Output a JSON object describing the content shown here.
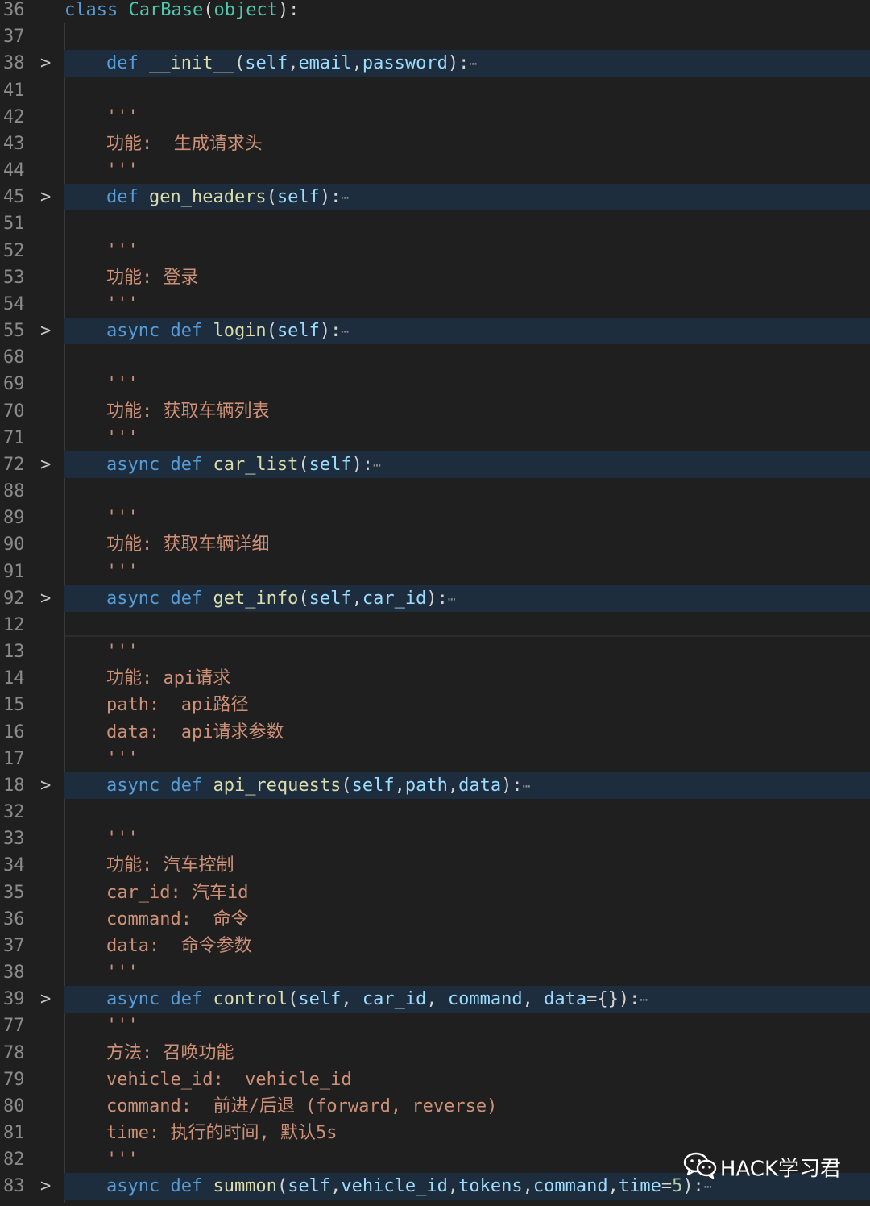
{
  "lines": [
    {
      "n": "36",
      "fold": false,
      "hl": false,
      "indent": false,
      "tokens": [
        [
          "kw",
          "class "
        ],
        [
          "cls",
          "CarBase"
        ],
        [
          "punc",
          "("
        ],
        [
          "cls",
          "object"
        ],
        [
          "punc",
          "):"
        ]
      ]
    },
    {
      "n": "37",
      "fold": false,
      "hl": false,
      "indent": false,
      "tokens": []
    },
    {
      "n": "38",
      "fold": true,
      "hl": true,
      "indent": true,
      "ellipsis": true,
      "tokens": [
        [
          "kw",
          "def "
        ],
        [
          "fn",
          "__init__"
        ],
        [
          "punc",
          "("
        ],
        [
          "param",
          "self"
        ],
        [
          "punc",
          ","
        ],
        [
          "param",
          "email"
        ],
        [
          "punc",
          ","
        ],
        [
          "param",
          "password"
        ],
        [
          "punc",
          "):"
        ]
      ]
    },
    {
      "n": "41",
      "fold": false,
      "hl": false,
      "indent": true,
      "tokens": []
    },
    {
      "n": "42",
      "fold": false,
      "hl": false,
      "indent": true,
      "tokens": [
        [
          "str",
          "'''"
        ]
      ]
    },
    {
      "n": "43",
      "fold": false,
      "hl": false,
      "indent": true,
      "tokens": [
        [
          "str",
          "功能:  生成请求头"
        ]
      ]
    },
    {
      "n": "44",
      "fold": false,
      "hl": false,
      "indent": true,
      "tokens": [
        [
          "str",
          "'''"
        ]
      ]
    },
    {
      "n": "45",
      "fold": true,
      "hl": true,
      "indent": true,
      "ellipsis": true,
      "tokens": [
        [
          "kw",
          "def "
        ],
        [
          "fn",
          "gen_headers"
        ],
        [
          "punc",
          "("
        ],
        [
          "param",
          "self"
        ],
        [
          "punc",
          "):"
        ]
      ]
    },
    {
      "n": "51",
      "fold": false,
      "hl": false,
      "indent": true,
      "tokens": []
    },
    {
      "n": "52",
      "fold": false,
      "hl": false,
      "indent": true,
      "tokens": [
        [
          "str",
          "'''"
        ]
      ]
    },
    {
      "n": "53",
      "fold": false,
      "hl": false,
      "indent": true,
      "tokens": [
        [
          "str",
          "功能: 登录"
        ]
      ]
    },
    {
      "n": "54",
      "fold": false,
      "hl": false,
      "indent": true,
      "tokens": [
        [
          "str",
          "'''"
        ]
      ]
    },
    {
      "n": "55",
      "fold": true,
      "hl": true,
      "indent": true,
      "ellipsis": true,
      "tokens": [
        [
          "kw",
          "async def "
        ],
        [
          "fn",
          "login"
        ],
        [
          "punc",
          "("
        ],
        [
          "param",
          "self"
        ],
        [
          "punc",
          "):"
        ]
      ]
    },
    {
      "n": "68",
      "fold": false,
      "hl": false,
      "indent": true,
      "tokens": []
    },
    {
      "n": "69",
      "fold": false,
      "hl": false,
      "indent": true,
      "tokens": [
        [
          "str",
          "'''"
        ]
      ]
    },
    {
      "n": "70",
      "fold": false,
      "hl": false,
      "indent": true,
      "tokens": [
        [
          "str",
          "功能: 获取车辆列表"
        ]
      ]
    },
    {
      "n": "71",
      "fold": false,
      "hl": false,
      "indent": true,
      "tokens": [
        [
          "str",
          "'''"
        ]
      ]
    },
    {
      "n": "72",
      "fold": true,
      "hl": true,
      "indent": true,
      "ellipsis": true,
      "tokens": [
        [
          "kw",
          "async def "
        ],
        [
          "fn",
          "car_list"
        ],
        [
          "punc",
          "("
        ],
        [
          "param",
          "self"
        ],
        [
          "punc",
          "):"
        ]
      ]
    },
    {
      "n": "88",
      "fold": false,
      "hl": false,
      "indent": true,
      "tokens": []
    },
    {
      "n": "89",
      "fold": false,
      "hl": false,
      "indent": true,
      "tokens": [
        [
          "str",
          "'''"
        ]
      ]
    },
    {
      "n": "90",
      "fold": false,
      "hl": false,
      "indent": true,
      "tokens": [
        [
          "str",
          "功能: 获取车辆详细"
        ]
      ]
    },
    {
      "n": "91",
      "fold": false,
      "hl": false,
      "indent": true,
      "tokens": [
        [
          "str",
          "'''"
        ]
      ]
    },
    {
      "n": "92",
      "fold": true,
      "hl": true,
      "indent": true,
      "ellipsis": true,
      "tokens": [
        [
          "kw",
          "async def "
        ],
        [
          "fn",
          "get_info"
        ],
        [
          "punc",
          "("
        ],
        [
          "param",
          "self"
        ],
        [
          "punc",
          ","
        ],
        [
          "param",
          "car_id"
        ],
        [
          "punc",
          "):"
        ]
      ]
    },
    {
      "n": "12",
      "fold": false,
      "hl": false,
      "indent": true,
      "tokens": []
    },
    {
      "n": "13",
      "fold": false,
      "hl": false,
      "indent": true,
      "tokens": [
        [
          "str",
          "'''"
        ]
      ]
    },
    {
      "n": "14",
      "fold": false,
      "hl": false,
      "indent": true,
      "tokens": [
        [
          "str",
          "功能: api请求"
        ]
      ]
    },
    {
      "n": "15",
      "fold": false,
      "hl": false,
      "indent": true,
      "tokens": [
        [
          "str",
          "path:  api路径"
        ]
      ]
    },
    {
      "n": "16",
      "fold": false,
      "hl": false,
      "indent": true,
      "tokens": [
        [
          "str",
          "data:  api请求参数"
        ]
      ]
    },
    {
      "n": "17",
      "fold": false,
      "hl": false,
      "indent": true,
      "tokens": [
        [
          "str",
          "'''"
        ]
      ]
    },
    {
      "n": "18",
      "fold": true,
      "hl": true,
      "indent": true,
      "ellipsis": true,
      "tokens": [
        [
          "kw",
          "async def "
        ],
        [
          "fn",
          "api_requests"
        ],
        [
          "punc",
          "("
        ],
        [
          "param",
          "self"
        ],
        [
          "punc",
          ","
        ],
        [
          "param",
          "path"
        ],
        [
          "punc",
          ","
        ],
        [
          "param",
          "data"
        ],
        [
          "punc",
          "):"
        ]
      ]
    },
    {
      "n": "32",
      "fold": false,
      "hl": false,
      "indent": true,
      "tokens": []
    },
    {
      "n": "33",
      "fold": false,
      "hl": false,
      "indent": true,
      "tokens": [
        [
          "str",
          "'''"
        ]
      ]
    },
    {
      "n": "34",
      "fold": false,
      "hl": false,
      "indent": true,
      "tokens": [
        [
          "str",
          "功能: 汽车控制"
        ]
      ]
    },
    {
      "n": "35",
      "fold": false,
      "hl": false,
      "indent": true,
      "tokens": [
        [
          "str",
          "car_id: 汽车id"
        ]
      ]
    },
    {
      "n": "36",
      "fold": false,
      "hl": false,
      "indent": true,
      "tokens": [
        [
          "str",
          "command:  命令"
        ]
      ]
    },
    {
      "n": "37",
      "fold": false,
      "hl": false,
      "indent": true,
      "tokens": [
        [
          "str",
          "data:  命令参数"
        ]
      ]
    },
    {
      "n": "38",
      "fold": false,
      "hl": false,
      "indent": true,
      "tokens": [
        [
          "str",
          "'''"
        ]
      ]
    },
    {
      "n": "39",
      "fold": true,
      "hl": true,
      "indent": true,
      "ellipsis": true,
      "tokens": [
        [
          "kw",
          "async def "
        ],
        [
          "fn",
          "control"
        ],
        [
          "punc",
          "("
        ],
        [
          "param",
          "self"
        ],
        [
          "punc",
          ", "
        ],
        [
          "param",
          "car_id"
        ],
        [
          "punc",
          ", "
        ],
        [
          "param",
          "command"
        ],
        [
          "punc",
          ", "
        ],
        [
          "param",
          "data"
        ],
        [
          "punc",
          "={}):"
        ]
      ]
    },
    {
      "n": "77",
      "fold": false,
      "hl": false,
      "indent": true,
      "tokens": [
        [
          "str",
          "'''"
        ]
      ]
    },
    {
      "n": "78",
      "fold": false,
      "hl": false,
      "indent": true,
      "tokens": [
        [
          "str",
          "方法: 召唤功能"
        ]
      ]
    },
    {
      "n": "79",
      "fold": false,
      "hl": false,
      "indent": true,
      "tokens": [
        [
          "str",
          "vehicle_id:  vehicle_id"
        ]
      ]
    },
    {
      "n": "80",
      "fold": false,
      "hl": false,
      "indent": true,
      "tokens": [
        [
          "str",
          "command:  前进/后退 (forward, reverse)"
        ]
      ]
    },
    {
      "n": "81",
      "fold": false,
      "hl": false,
      "indent": true,
      "tokens": [
        [
          "str",
          "time: 执行的时间, 默认5s"
        ]
      ]
    },
    {
      "n": "82",
      "fold": false,
      "hl": false,
      "indent": true,
      "tokens": [
        [
          "str",
          "'''"
        ]
      ]
    },
    {
      "n": "83",
      "fold": true,
      "hl": true,
      "indent": true,
      "ellipsis": true,
      "tokens": [
        [
          "kw",
          "async def "
        ],
        [
          "fn",
          "summon"
        ],
        [
          "punc",
          "("
        ],
        [
          "param",
          "self"
        ],
        [
          "punc",
          ","
        ],
        [
          "param",
          "vehicle_id"
        ],
        [
          "punc",
          ","
        ],
        [
          "param",
          "tokens"
        ],
        [
          "punc",
          ","
        ],
        [
          "param",
          "command"
        ],
        [
          "punc",
          ","
        ],
        [
          "param",
          "time"
        ],
        [
          "punc",
          "="
        ],
        [
          "num",
          "5"
        ],
        [
          "punc",
          "):"
        ]
      ]
    }
  ],
  "ellipsis_glyph": "⋯",
  "fold_glyph": ">",
  "watermark": {
    "text": "HACK学习君",
    "icon": "wechat-icon"
  }
}
